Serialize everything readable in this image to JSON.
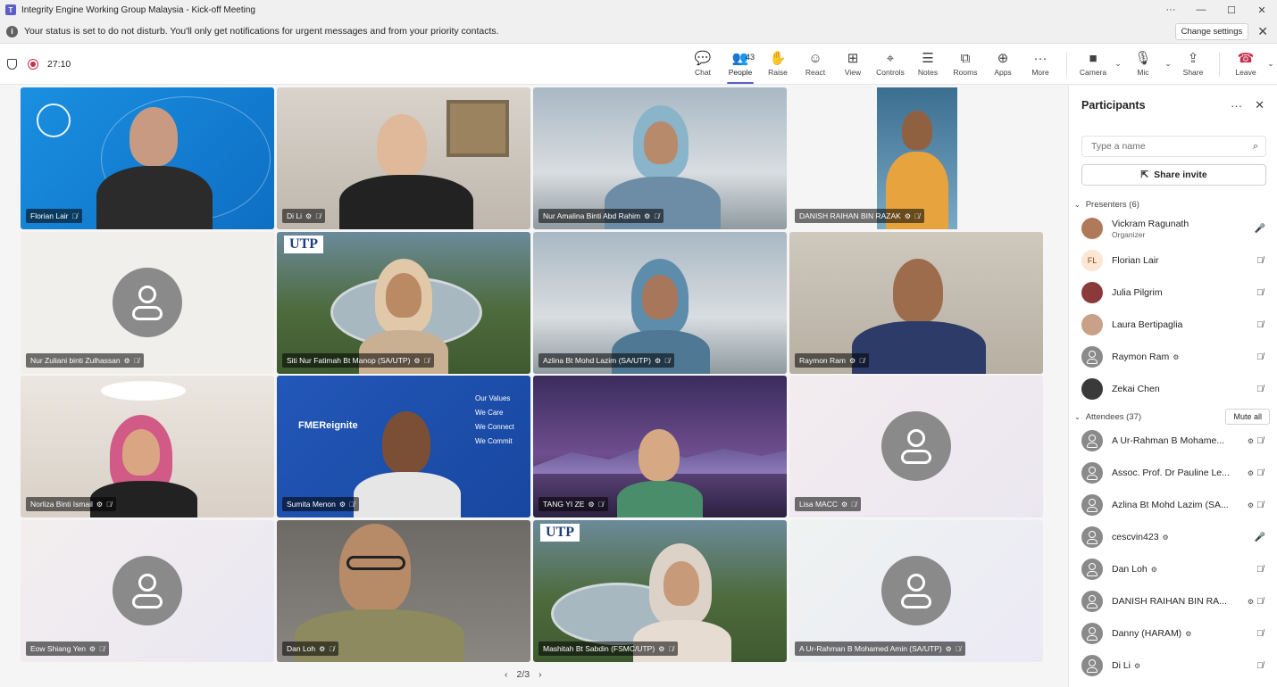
{
  "window": {
    "title": "Integrity Engine Working Group Malaysia - Kick-off Meeting",
    "controls": [
      "···",
      "—",
      "☐",
      "✕"
    ]
  },
  "banner": {
    "message": "Your status is set to do not disturb. You'll only get notifications for urgent messages and from your priority contacts.",
    "change_settings": "Change settings"
  },
  "toolbar": {
    "timer": "27:10",
    "people_count": "43",
    "tools": [
      {
        "label": "Chat",
        "icon": "chat-icon"
      },
      {
        "label": "People",
        "icon": "people-icon"
      },
      {
        "label": "Raise",
        "icon": "raise-hand-icon"
      },
      {
        "label": "React",
        "icon": "react-icon"
      },
      {
        "label": "View",
        "icon": "view-icon"
      },
      {
        "label": "Controls",
        "icon": "controls-icon"
      },
      {
        "label": "Notes",
        "icon": "notes-icon"
      },
      {
        "label": "Rooms",
        "icon": "rooms-icon"
      },
      {
        "label": "Apps",
        "icon": "apps-icon"
      },
      {
        "label": "More",
        "icon": "more-icon"
      }
    ],
    "camera_label": "Camera",
    "mic_label": "Mic",
    "share_label": "Share",
    "leave_label": "Leave"
  },
  "grid": {
    "pager": "2/3",
    "tiles": [
      {
        "name": "Florian Lair",
        "kind": "video"
      },
      {
        "name": "Di Li",
        "kind": "video"
      },
      {
        "name": "Nur Amalina Binti Abd Rahim",
        "kind": "video"
      },
      {
        "name": "DANISH RAIHAN BIN RAZAK",
        "kind": "video"
      },
      {
        "name": "Nur Zuliani binti Zulhassan",
        "kind": "avatar"
      },
      {
        "name": "Siti Nur Fatimah Bt Manop (SA/UTP)",
        "kind": "video"
      },
      {
        "name": "Azlina Bt Mohd Lazim (SA/UTP)",
        "kind": "video"
      },
      {
        "name": "Raymon Ram",
        "kind": "video"
      },
      {
        "name": "Norliza Binti Ismail",
        "kind": "video"
      },
      {
        "name": "Sumita Menon",
        "kind": "video"
      },
      {
        "name": "TANG YI ZE",
        "kind": "video"
      },
      {
        "name": "Lisa MACC",
        "kind": "avatar"
      },
      {
        "name": "Eow Shiang Yen",
        "kind": "avatar"
      },
      {
        "name": "Dan Loh",
        "kind": "video"
      },
      {
        "name": "Mashitah Bt Sabdin (FSMC/UTP)",
        "kind": "video"
      },
      {
        "name": "A Ur-Rahman B Mohamed Amin (SA/UTP)",
        "kind": "avatar"
      }
    ],
    "utp_logo": "UTP",
    "fme_logo": "FMEReignite",
    "fme_values": [
      "Our Values",
      "We Care",
      "We Connect",
      "We Commit"
    ]
  },
  "panel": {
    "title": "Participants",
    "search_placeholder": "Type a name",
    "share_invite": "Share invite",
    "presenters_header": "Presenters (6)",
    "attendees_header": "Attendees (37)",
    "mute_all": "Mute all",
    "presenters": [
      {
        "name": "Vickram Ragunath",
        "role": "Organizer",
        "avatar": "photo",
        "mic": "on"
      },
      {
        "name": "Florian Lair",
        "role": "",
        "avatar": "FL",
        "mic": "off"
      },
      {
        "name": "Julia Pilgrim",
        "role": "",
        "avatar": "photo",
        "mic": "off"
      },
      {
        "name": "Laura Bertipaglia",
        "role": "",
        "avatar": "photo",
        "mic": "off"
      },
      {
        "name": "Raymon Ram",
        "role": "",
        "avatar": "default",
        "mic": "off"
      },
      {
        "name": "Zekai Chen",
        "role": "",
        "avatar": "photo",
        "mic": "off"
      }
    ],
    "attendees": [
      {
        "name": "A Ur-Rahman B Mohame...",
        "mic": "off"
      },
      {
        "name": "Assoc. Prof. Dr Pauline Le...",
        "mic": "off"
      },
      {
        "name": "Azlina Bt Mohd Lazim (SA...",
        "mic": "off"
      },
      {
        "name": "cescvin423",
        "mic": "on"
      },
      {
        "name": "Dan Loh",
        "mic": "off"
      },
      {
        "name": "DANISH RAIHAN BIN RA...",
        "mic": "off"
      },
      {
        "name": "Danny (HARAM)",
        "mic": "off"
      },
      {
        "name": "Di Li",
        "mic": "off"
      }
    ]
  }
}
